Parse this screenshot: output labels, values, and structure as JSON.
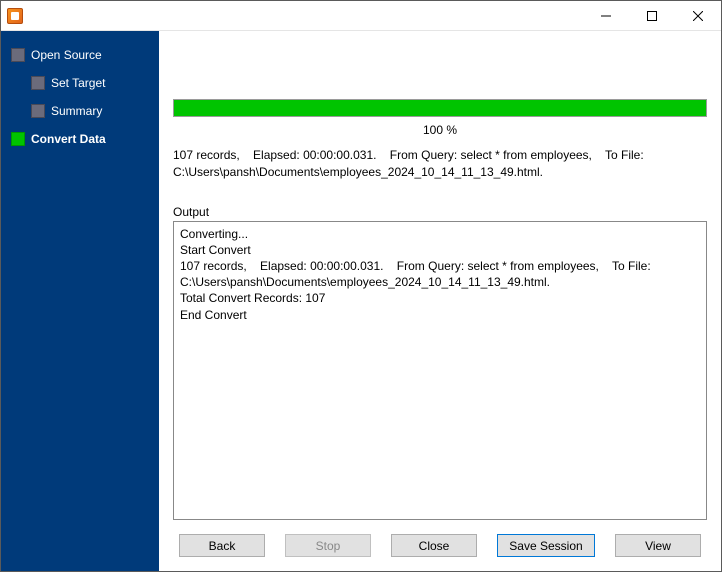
{
  "sidebar": {
    "items": [
      {
        "label": "Open Source"
      },
      {
        "label": "Set Target"
      },
      {
        "label": "Summary"
      },
      {
        "label": "Convert Data"
      }
    ]
  },
  "progress": {
    "percent_label": "100 %"
  },
  "status_line": "107 records,    Elapsed: 00:00:00.031.    From Query: select * from employees,    To File: C:\\Users\\pansh\\Documents\\employees_2024_10_14_11_13_49.html.",
  "output": {
    "label": "Output",
    "log": "Converting...\nStart Convert\n107 records,    Elapsed: 00:00:00.031.    From Query: select * from employees,    To File: C:\\Users\\pansh\\Documents\\employees_2024_10_14_11_13_49.html.\nTotal Convert Records: 107\nEnd Convert"
  },
  "buttons": {
    "back": "Back",
    "stop": "Stop",
    "close": "Close",
    "save_session": "Save Session",
    "view": "View"
  }
}
